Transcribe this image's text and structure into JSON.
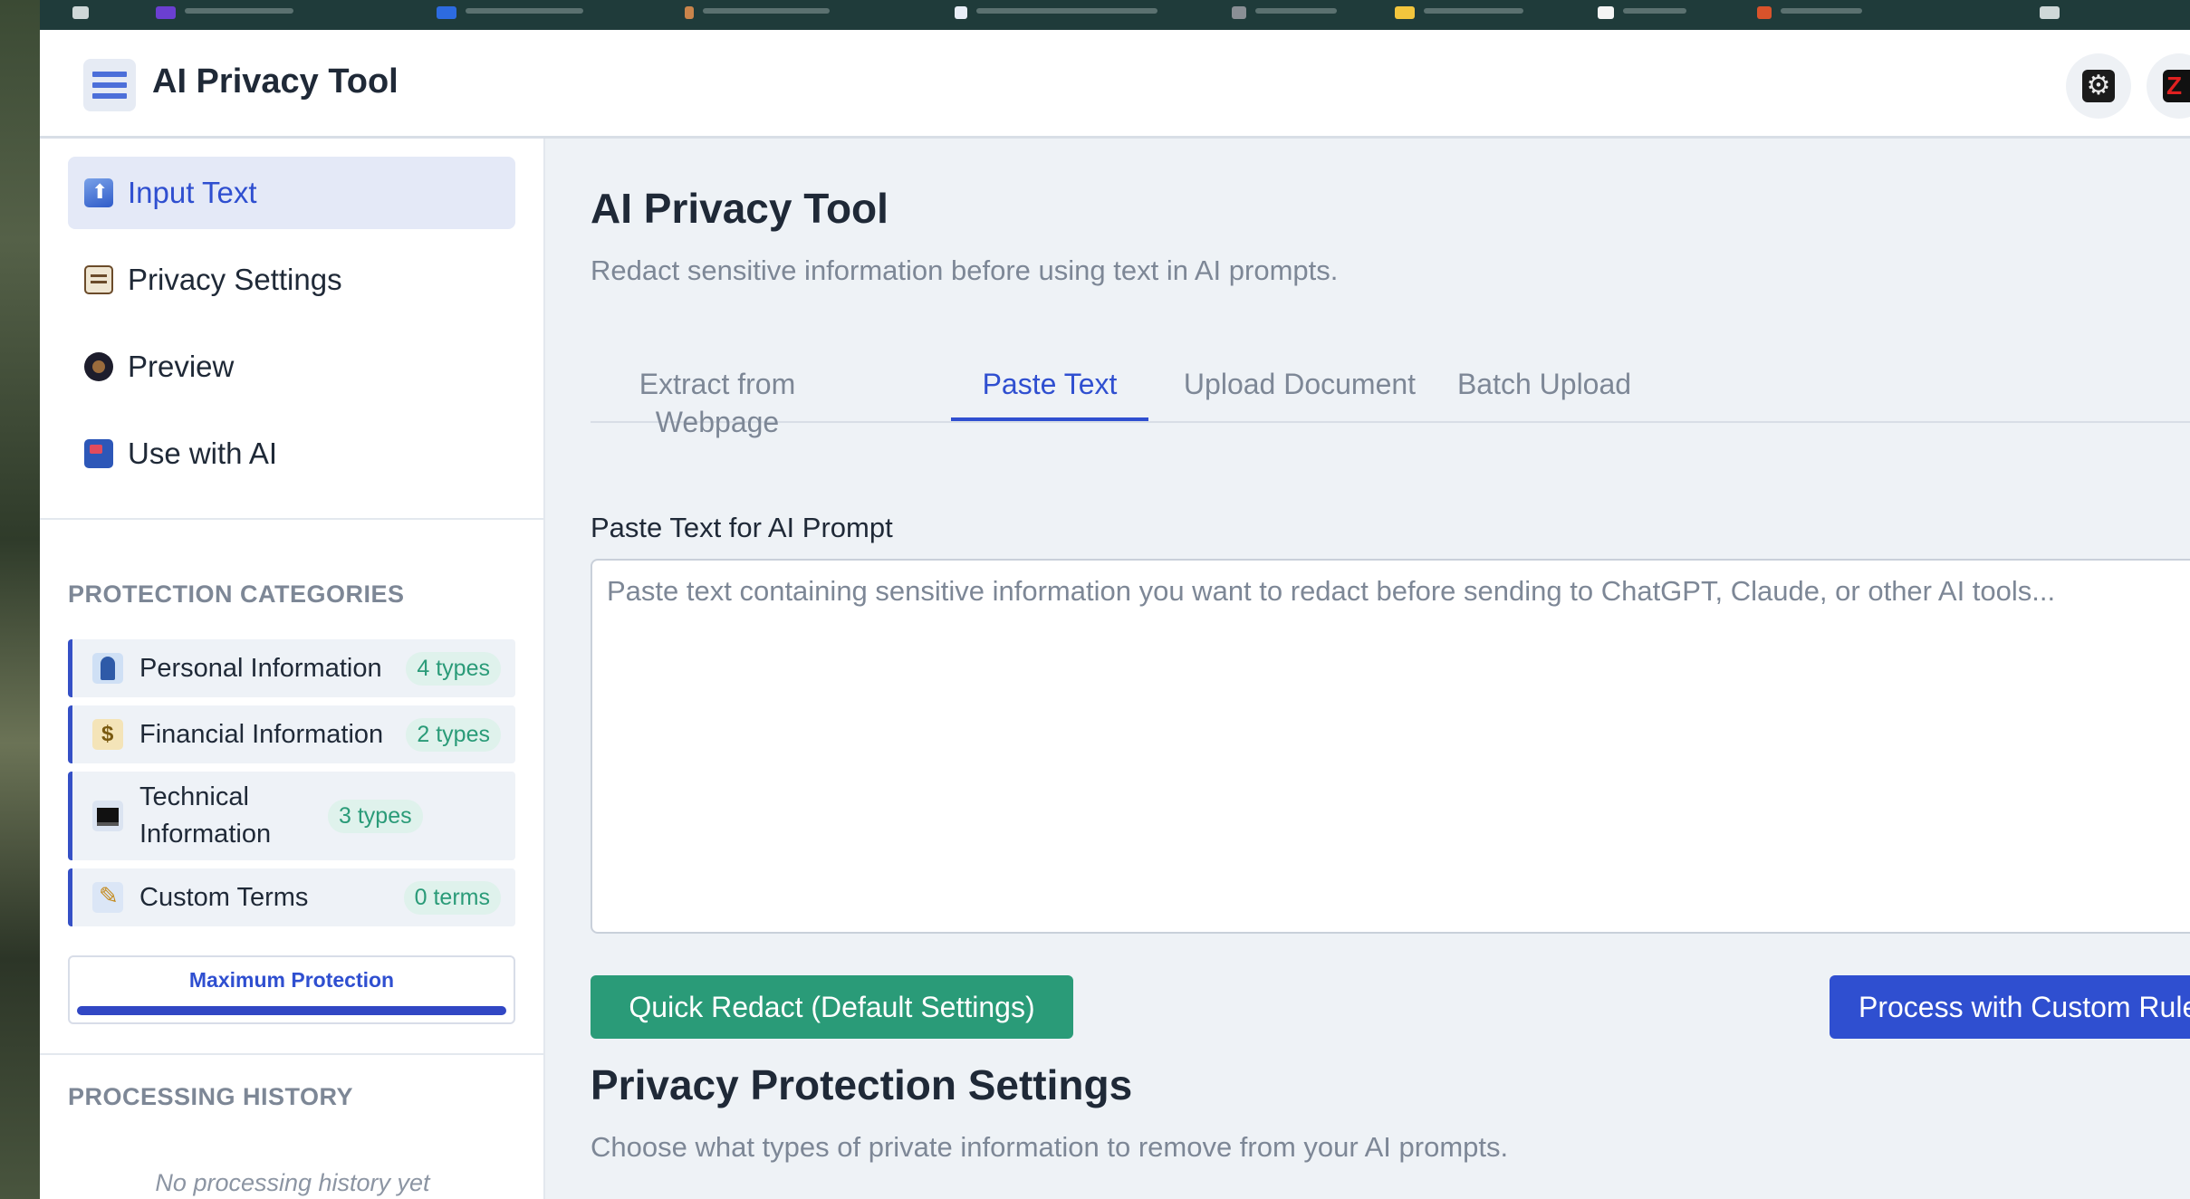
{
  "app": {
    "title": "AI Privacy Tool"
  },
  "sidebar": {
    "nav": [
      {
        "label": "Input Text",
        "icon": "upload-icon",
        "active": true
      },
      {
        "label": "Privacy Settings",
        "icon": "notepad-icon",
        "active": false
      },
      {
        "label": "Preview",
        "icon": "eye-icon",
        "active": false
      },
      {
        "label": "Use with AI",
        "icon": "inbox-icon",
        "active": false
      }
    ],
    "categories_title": "PROTECTION CATEGORIES",
    "categories": [
      {
        "label": "Personal Information",
        "badge": "4 types",
        "icon": "person-icon"
      },
      {
        "label": "Financial Information",
        "badge": "2 types",
        "icon": "money-bag-icon"
      },
      {
        "label": "Technical Information",
        "badge": "3 types",
        "icon": "laptop-icon"
      },
      {
        "label": "Custom Terms",
        "badge": "0 terms",
        "icon": "pencil-icon"
      }
    ],
    "protection": {
      "label": "Maximum Protection",
      "level": 1.0
    },
    "history_title": "PROCESSING HISTORY",
    "history_empty": "No processing history yet"
  },
  "main": {
    "title": "AI Privacy Tool",
    "subtitle": "Redact sensitive information before using text in AI prompts.",
    "tabs": [
      {
        "label": "Extract from Webpage",
        "active": false
      },
      {
        "label": "Paste Text",
        "active": true
      },
      {
        "label": "Upload Document",
        "active": false
      },
      {
        "label": "Batch Upload",
        "active": false
      }
    ],
    "input": {
      "label": "Paste Text for AI Prompt",
      "value": "",
      "placeholder": "Paste text containing sensitive information you want to redact before sending to ChatGPT, Claude, or other AI tools..."
    },
    "quick_button": "Quick Redact (Default Settings)",
    "custom_button": "Process with Custom Rules",
    "settings_title": "Privacy Protection Settings",
    "settings_subtitle": "Choose what types of private information to remove from your AI prompts."
  },
  "colors": {
    "accent": "#2f4fd0",
    "success": "#2a9b78",
    "bookmarks_bar": "#1f3b3a"
  }
}
